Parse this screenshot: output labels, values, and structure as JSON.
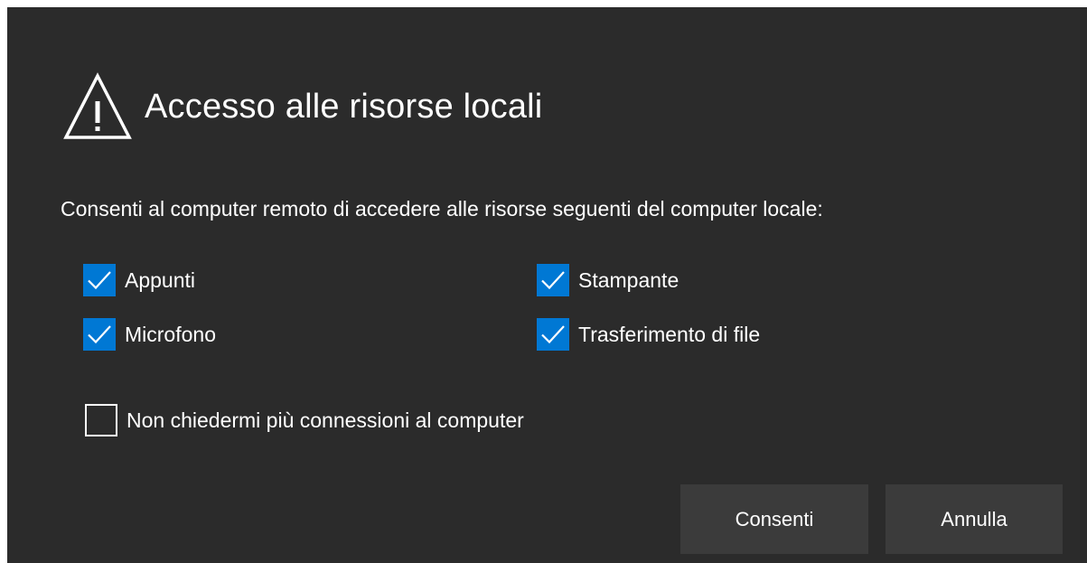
{
  "dialog": {
    "title": "Accesso alle risorse locali",
    "title_icon": "warning-triangle-icon",
    "description": "Consenti al computer remoto di accedere alle risorse seguenti del computer locale:",
    "resources": [
      {
        "label": "Appunti",
        "checked": true
      },
      {
        "label": "Stampante",
        "checked": true
      },
      {
        "label": "Microfono",
        "checked": true
      },
      {
        "label": "Trasferimento di file",
        "checked": true
      }
    ],
    "dont_ask": {
      "label": "Non chiedermi più connessioni al computer",
      "checked": false
    },
    "buttons": {
      "allow_label": "Consenti",
      "cancel_label": "Annulla"
    },
    "colors": {
      "background": "#2b2b2b",
      "accent": "#0078d4",
      "button": "#3b3b3b",
      "text": "#ffffff"
    }
  }
}
